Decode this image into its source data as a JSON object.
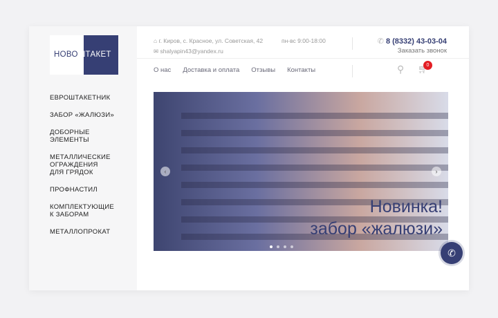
{
  "logo": {
    "part1": "НОВО",
    "part2": "ШТАКЕТ"
  },
  "menu": [
    "Евроштакетник",
    "Забор «жалюзи»",
    "Доборные элементы",
    "Металлические ограждения для грядок",
    "Профнастил",
    "Комплектующие к заборам",
    "Металлопрокат"
  ],
  "contacts": {
    "address": "г. Киров, с. Красное, ул. Советская, 42",
    "hours": "пн-вс 9:00-18:00",
    "email": "shalyapin43@yandex.ru",
    "phone": "8 (8332) 43-03-04",
    "callback": "Заказать звонок"
  },
  "nav": [
    "О нас",
    "Доставка и оплата",
    "Отзывы",
    "Контакты"
  ],
  "cart": {
    "count": "0"
  },
  "slider": {
    "line1": "Новинка!",
    "line2": "забор «жалюзи»",
    "slides": 4,
    "active": 1
  },
  "colors": {
    "brand": "#363f74",
    "badge": "#e31e24"
  }
}
